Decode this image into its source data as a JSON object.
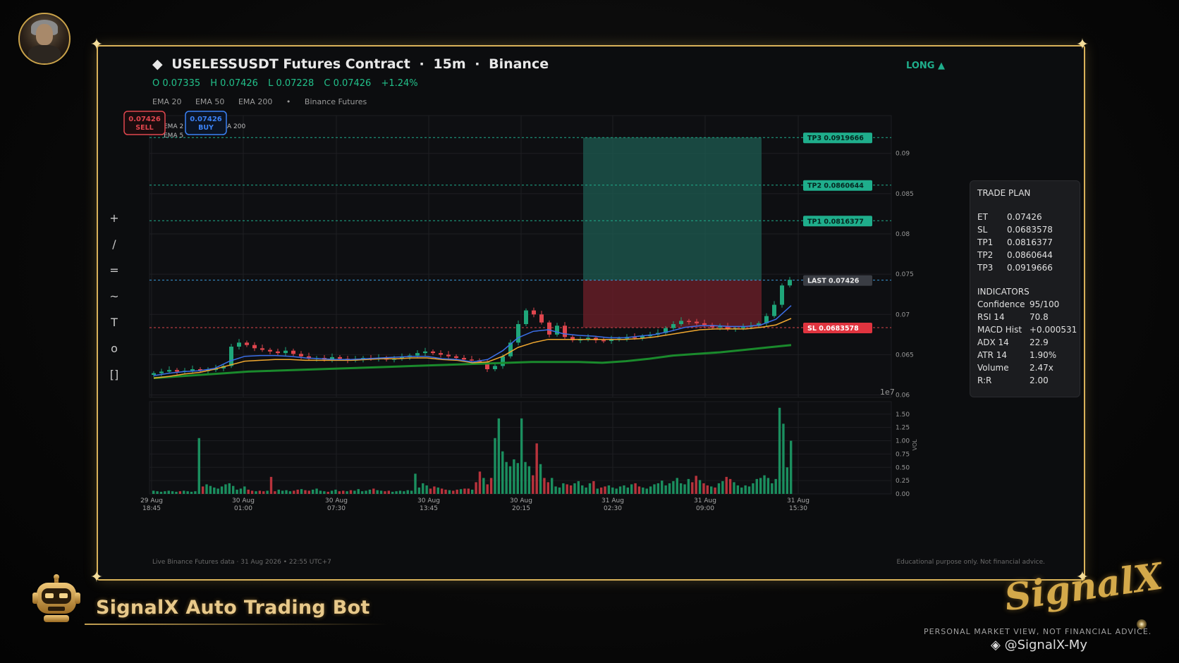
{
  "header": {
    "symbol_icon": "diamond-icon",
    "symbol": "USELESSUSDT Futures Contract",
    "separator": "·",
    "timeframe": "15m",
    "exchange": "Binance",
    "ohlc": {
      "open": "O 0.07335",
      "high": "H 0.07426",
      "low": "L 0.07228",
      "close": "C 0.07426",
      "change": "+1.24%"
    },
    "ema_legend": [
      "EMA 20",
      "EMA 50",
      "EMA 200",
      "•",
      "Binance Futures"
    ],
    "position_side": "LONG ▲"
  },
  "toolbar": {
    "tools": [
      "+",
      "/",
      "=",
      "~",
      "T",
      "o",
      "[]"
    ]
  },
  "order_buttons": {
    "sell": {
      "price": "0.07426",
      "label": "SELL"
    },
    "buy": {
      "price": "0.07426",
      "label": "BUY"
    },
    "legend_fragments": [
      "EMA 2",
      "EMA 5",
      "A 200"
    ]
  },
  "price_levels": {
    "tp3": "TP3  0.0919666",
    "tp2": "TP2  0.0860644",
    "tp1": "TP1  0.0816377",
    "last": "LAST  0.07426",
    "sl": "SL  0.0683578"
  },
  "chart_data": {
    "type": "candlestick",
    "y_ticks": [
      "0.09",
      "0.085",
      "0.08",
      "0.075",
      "0.07",
      "0.065",
      "0.06"
    ],
    "ylim": [
      0.0597,
      0.0947
    ],
    "y_offset_label": "1e7",
    "volume_ticks": [
      "1.50",
      "1.25",
      "1.00",
      "0.75",
      "0.50",
      "0.25",
      "0.00"
    ],
    "volume_ylim": [
      0,
      1.63
    ],
    "volume_label": "VOL",
    "x_tick_labels": [
      [
        "29 Aug",
        "18:45"
      ],
      [
        "30 Aug",
        "01:00"
      ],
      [
        "30 Aug",
        "07:30"
      ],
      [
        "30 Aug",
        "13:45"
      ],
      [
        "30 Aug",
        "20:15"
      ],
      [
        "31 Aug",
        "02:30"
      ],
      [
        "31 Aug",
        "09:00"
      ],
      [
        "31 Aug",
        "15:30"
      ]
    ],
    "close_path": [
      0.0627,
      0.0629,
      0.0631,
      0.0629,
      0.063,
      0.0632,
      0.063,
      0.0631,
      0.0633,
      0.0636,
      0.066,
      0.0665,
      0.0662,
      0.0658,
      0.0656,
      0.0654,
      0.0652,
      0.0655,
      0.0651,
      0.0648,
      0.0645,
      0.0646,
      0.0644,
      0.0647,
      0.0645,
      0.0643,
      0.0644,
      0.0646,
      0.0645,
      0.0646,
      0.0644,
      0.0645,
      0.0647,
      0.0649,
      0.0652,
      0.0654,
      0.0652,
      0.065,
      0.0648,
      0.0646,
      0.0644,
      0.0643,
      0.0641,
      0.0632,
      0.0636,
      0.0648,
      0.0665,
      0.0688,
      0.0705,
      0.07,
      0.069,
      0.0675,
      0.0686,
      0.0672,
      0.0668,
      0.0669,
      0.0671,
      0.0668,
      0.0667,
      0.0669,
      0.067,
      0.0672,
      0.0671,
      0.0673,
      0.0675,
      0.0677,
      0.0683,
      0.0688,
      0.0692,
      0.0691,
      0.0689,
      0.0687,
      0.0684,
      0.0685,
      0.0682,
      0.0683,
      0.0685,
      0.0686,
      0.0689,
      0.0698,
      0.0712,
      0.0736,
      0.0743
    ],
    "ema20_path": [
      0.0624,
      0.0627,
      0.0629,
      0.063,
      0.0633,
      0.0642,
      0.0648,
      0.0649,
      0.0649,
      0.0648,
      0.0646,
      0.0645,
      0.0644,
      0.0644,
      0.0645,
      0.0646,
      0.0647,
      0.0648,
      0.0648,
      0.0645,
      0.0644,
      0.0641,
      0.0644,
      0.0655,
      0.0671,
      0.0679,
      0.0681,
      0.0676,
      0.0674,
      0.0673,
      0.0671,
      0.0671,
      0.0673,
      0.0675,
      0.0679,
      0.0684,
      0.0686,
      0.0686,
      0.0685,
      0.0685,
      0.0687,
      0.0694,
      0.0711
    ],
    "ema50_path": [
      0.0621,
      0.0623,
      0.0626,
      0.0628,
      0.0632,
      0.0637,
      0.0642,
      0.0643,
      0.0644,
      0.0644,
      0.0643,
      0.0643,
      0.0643,
      0.0643,
      0.0644,
      0.0645,
      0.0645,
      0.0646,
      0.0646,
      0.0644,
      0.0643,
      0.064,
      0.0641,
      0.0648,
      0.0659,
      0.0665,
      0.0669,
      0.0669,
      0.0669,
      0.0669,
      0.0669,
      0.0669,
      0.067,
      0.0672,
      0.0675,
      0.0678,
      0.0681,
      0.0682,
      0.0682,
      0.0682,
      0.0684,
      0.0687,
      0.0695
    ],
    "ema200_path": [
      0.0621,
      0.0623,
      0.0625,
      0.0627,
      0.0629,
      0.063,
      0.0631,
      0.0632,
      0.0633,
      0.0634,
      0.0635,
      0.0636,
      0.0637,
      0.0638,
      0.0639,
      0.064,
      0.0641,
      0.0641,
      0.0641,
      0.064,
      0.0642,
      0.0645,
      0.0649,
      0.0651,
      0.0653,
      0.0656,
      0.0659,
      0.0662
    ],
    "volume_profile": [
      0.06,
      0.05,
      0.04,
      0.05,
      0.06,
      0.05,
      0.04,
      0.05,
      0.06,
      0.05,
      0.04,
      0.05,
      1.05,
      0.14,
      0.18,
      0.15,
      0.12,
      0.1,
      0.14,
      0.18,
      0.2,
      0.15,
      0.08,
      0.1,
      0.14,
      0.08,
      0.06,
      0.05,
      0.06,
      0.05,
      0.06,
      0.32,
      0.05,
      0.08,
      0.06,
      0.07,
      0.05,
      0.06,
      0.08,
      0.09,
      0.07,
      0.06,
      0.08,
      0.1,
      0.06,
      0.05,
      0.04,
      0.06,
      0.08,
      0.05,
      0.06,
      0.05,
      0.07,
      0.06,
      0.09,
      0.05,
      0.06,
      0.08,
      0.1,
      0.07,
      0.06,
      0.05,
      0.06,
      0.04,
      0.05,
      0.06,
      0.05,
      0.07,
      0.06,
      0.38,
      0.12,
      0.2,
      0.16,
      0.1,
      0.14,
      0.12,
      0.1,
      0.08,
      0.07,
      0.06,
      0.08,
      0.09,
      0.1,
      0.1,
      0.08,
      0.22,
      0.42,
      0.3,
      0.18,
      0.3,
      1.05,
      1.42,
      0.8,
      0.6,
      0.52,
      0.65,
      0.58,
      1.42,
      0.6,
      0.52,
      0.35,
      0.95,
      0.56,
      0.3,
      0.22,
      0.3,
      0.14,
      0.12,
      0.2,
      0.18,
      0.16,
      0.2,
      0.24,
      0.16,
      0.12,
      0.2,
      0.24,
      0.1,
      0.12,
      0.14,
      0.16,
      0.12,
      0.1,
      0.14,
      0.16,
      0.12,
      0.18,
      0.2,
      0.14,
      0.12,
      0.1,
      0.14,
      0.18,
      0.2,
      0.25,
      0.16,
      0.2,
      0.24,
      0.3,
      0.2,
      0.18,
      0.28,
      0.22,
      0.34,
      0.26,
      0.2,
      0.16,
      0.14,
      0.12,
      0.2,
      0.24,
      0.32,
      0.28,
      0.22,
      0.16,
      0.12,
      0.16,
      0.14,
      0.2,
      0.28,
      0.3,
      0.35,
      0.3,
      0.2,
      0.28,
      1.62,
      1.32,
      0.5,
      1.0
    ],
    "series": [
      {
        "name": "EMA 20",
        "color": "#3b6fe8"
      },
      {
        "name": "EMA 50",
        "color": "#f0a830"
      },
      {
        "name": "EMA 200",
        "color": "#1a8a2c"
      }
    ],
    "levels": {
      "tp3": 0.0919666,
      "tp2": 0.0860644,
      "tp1": 0.0816377,
      "last": 0.07426,
      "sl": 0.0683578
    },
    "zones": {
      "profit": {
        "from": 0.07426,
        "to": 0.0919666,
        "color": "#1d5c52"
      },
      "loss": {
        "from": 0.0683578,
        "to": 0.07426,
        "color": "#6a1e28"
      }
    }
  },
  "trade_plan": {
    "title": "TRADE PLAN",
    "entries": [
      {
        "k": "ET",
        "v": "0.07426"
      },
      {
        "k": "SL",
        "v": "0.0683578"
      },
      {
        "k": "TP1",
        "v": "0.0816377"
      },
      {
        "k": "TP2",
        "v": "0.0860644"
      },
      {
        "k": "TP3",
        "v": "0.0919666"
      }
    ],
    "indicators_title": "INDICATORS",
    "indicators": [
      {
        "k": "Confidence",
        "v": "95/100"
      },
      {
        "k": "RSI 14",
        "v": "70.8"
      },
      {
        "k": "MACD Hist",
        "v": "+0.000531"
      },
      {
        "k": "ADX 14",
        "v": "22.9"
      },
      {
        "k": "ATR 14",
        "v": "1.90%"
      },
      {
        "k": "Volume",
        "v": "2.47x"
      },
      {
        "k": "R:R",
        "v": "2.00"
      }
    ]
  },
  "footer": {
    "left": "Live Binance Futures data  ·  31 Aug 2026 • 22:55 UTC+7",
    "right": "Educational purpose only. Not financial advice."
  },
  "branding": {
    "bot_title": "SignalX Auto Trading Bot",
    "logo_text": "SignalX",
    "disclaimer": "PERSONAL MARKET VIEW, NOT FINANCIAL ADVICE.",
    "watermark": "◈ @SignalX-My"
  },
  "colors": {
    "accent_gold": "#d9b25a",
    "bull": "#1fa67a",
    "bear": "#e0464e",
    "tp": "#1fae8c",
    "sl": "#e0343f",
    "buy": "#3b82f6"
  }
}
